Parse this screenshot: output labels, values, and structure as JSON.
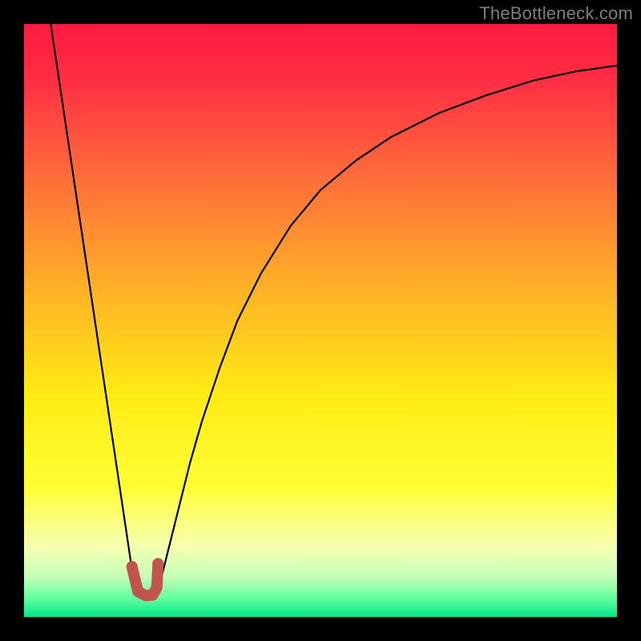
{
  "watermark": {
    "text": "TheBottleneck.com"
  },
  "chart_data": {
    "type": "line",
    "title": "",
    "xlabel": "",
    "ylabel": "",
    "xlim": [
      0,
      100
    ],
    "ylim": [
      0,
      100
    ],
    "grid": false,
    "legend": false,
    "background_gradient": {
      "stops": [
        {
          "offset": 0.0,
          "color": "#ff1a3e"
        },
        {
          "offset": 0.1,
          "color": "#ff3044"
        },
        {
          "offset": 0.25,
          "color": "#ff6a3a"
        },
        {
          "offset": 0.45,
          "color": "#ffb227"
        },
        {
          "offset": 0.62,
          "color": "#ffea14"
        },
        {
          "offset": 0.78,
          "color": "#ffff33"
        },
        {
          "offset": 0.88,
          "color": "#f7ffb0"
        },
        {
          "offset": 0.93,
          "color": "#c8ffb8"
        },
        {
          "offset": 0.97,
          "color": "#5fff9e"
        },
        {
          "offset": 1.0,
          "color": "#00e58a"
        }
      ]
    },
    "series": [
      {
        "name": "left-descent",
        "stroke": "#000000",
        "stroke_width": 2.2,
        "x": [
          4.5,
          18.8
        ],
        "y": [
          100,
          4
        ]
      },
      {
        "name": "right-saturating-curve",
        "stroke": "#000000",
        "stroke_width": 2.2,
        "x": [
          22.5,
          24,
          26,
          28,
          30,
          33,
          36,
          40,
          45,
          50,
          56,
          62,
          70,
          78,
          86,
          93,
          100
        ],
        "y": [
          4,
          10,
          18,
          26,
          33,
          42,
          50,
          58,
          66,
          72,
          77,
          81,
          85,
          88,
          90.5,
          92,
          93
        ]
      },
      {
        "name": "valley-marker",
        "stroke": "#c1554e",
        "stroke_width": 14,
        "linecap": "round",
        "x": [
          18.2,
          19.2,
          20.5,
          21.7,
          22.4,
          22.6
        ],
        "y": [
          8.5,
          4.3,
          3.6,
          3.7,
          5.0,
          9.0
        ]
      }
    ]
  }
}
